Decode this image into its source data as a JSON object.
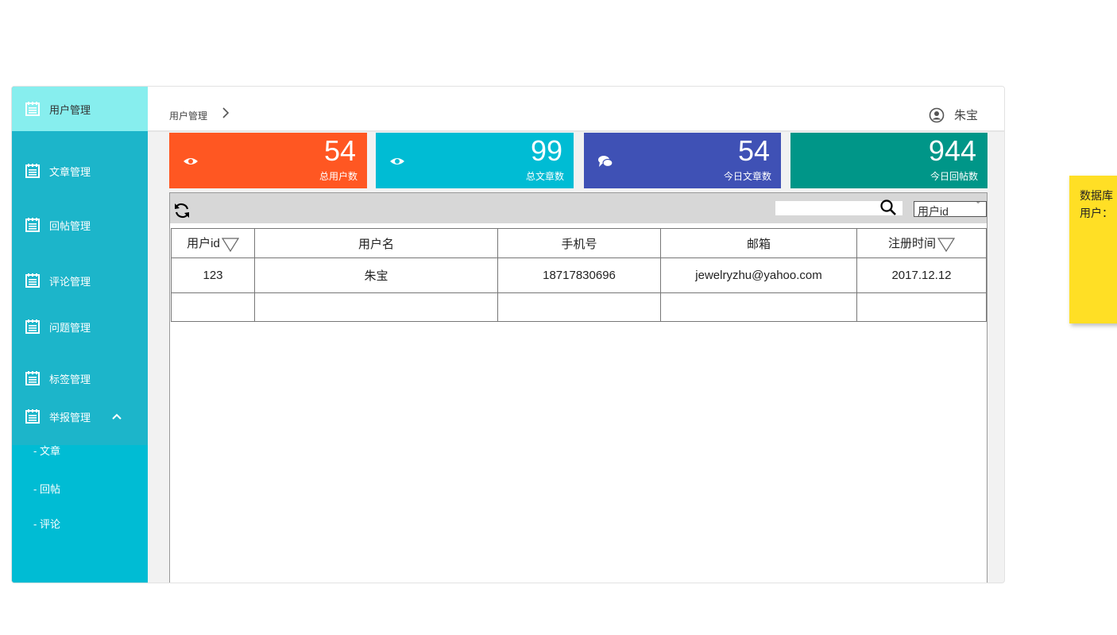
{
  "sidebar": {
    "items": [
      {
        "label": "用户管理",
        "icon": "notepad-icon",
        "active": true
      },
      {
        "label": "文章管理",
        "icon": "notepad-icon"
      },
      {
        "label": "回帖管理",
        "icon": "notepad-icon"
      },
      {
        "label": "评论管理",
        "icon": "notepad-icon"
      },
      {
        "label": "问题管理",
        "icon": "notepad-icon"
      },
      {
        "label": "标签管理",
        "icon": "notepad-icon"
      },
      {
        "label": "举报管理",
        "icon": "notepad-icon",
        "expanded": true
      }
    ],
    "sub_items": [
      {
        "label": "- 文章"
      },
      {
        "label": "- 回帖"
      },
      {
        "label": "- 评论"
      }
    ],
    "colors": {
      "bg": "#1cb5ca",
      "active_bg": "#87eeee",
      "sub_bg": "#00bcd4"
    }
  },
  "header": {
    "breadcrumb": "用户管理",
    "user_name": "朱宝"
  },
  "stats": [
    {
      "value": "54",
      "label": "总用户数",
      "icon": "eye-icon",
      "color": "#ff5722"
    },
    {
      "value": "99",
      "label": "总文章数",
      "icon": "eye-icon",
      "color": "#00bcd4"
    },
    {
      "value": "54",
      "label": "今日文章数",
      "icon": "chat-bubbles-icon",
      "color": "#3f51b5"
    },
    {
      "value": "944",
      "label": "今日回帖数",
      "icon": "",
      "color": "#009688"
    }
  ],
  "toolbar": {
    "search_value": "",
    "select_value": "用户id"
  },
  "table": {
    "columns": [
      "用户id",
      "用户名",
      "手机号",
      "邮箱",
      "注册时间"
    ],
    "rows": [
      [
        "123",
        "朱宝",
        "18717830696",
        "jewelryzhu@yahoo.com",
        "2017.12.12"
      ],
      [
        "",
        "",
        "",
        "",
        ""
      ]
    ]
  },
  "note": {
    "lines": [
      "数据库",
      "用户："
    ],
    "color": "#ffdf25"
  }
}
